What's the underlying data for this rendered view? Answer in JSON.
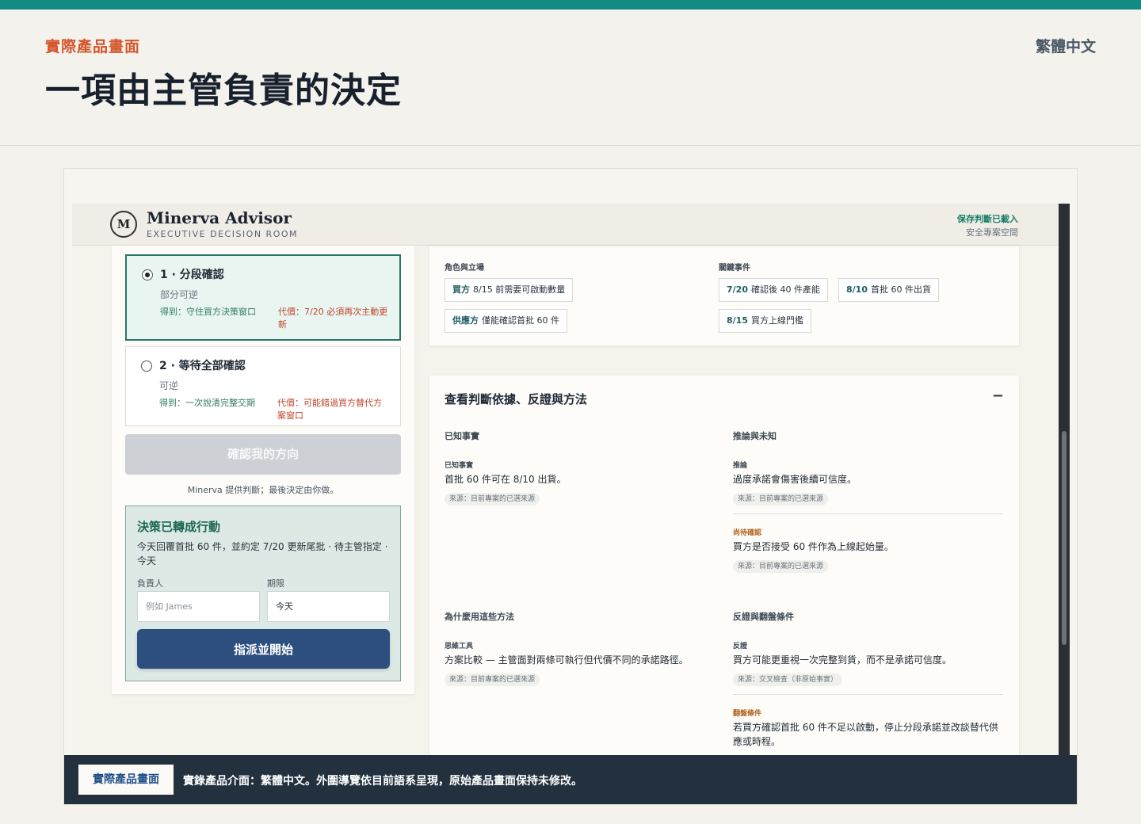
{
  "page": {
    "eyebrow": "實際產品畫面",
    "headline": "一項由主管負責的決定",
    "language": "繁體中文"
  },
  "app": {
    "brand_initial": "M",
    "brand_name": "Minerva Advisor",
    "brand_sub": "EXECUTIVE DECISION ROOM",
    "status_saved": "保存判斷已載入",
    "status_space": "安全專案空間"
  },
  "options": [
    {
      "title": "1 · 分段確認",
      "subtitle": "部分可逆",
      "gain": "得到：守住買方決策窗口",
      "cost": "代價：7/20 必須再次主動更新",
      "selected": true
    },
    {
      "title": "2 · 等待全部確認",
      "subtitle": "可逆",
      "gain": "得到：一次說清完整交期",
      "cost": "代價：可能錯過買方替代方案窗口",
      "selected": false
    }
  ],
  "confirm_button": "確認我的方向",
  "disclaimer": "Minerva 提供判斷；最後決定由你做。",
  "action": {
    "title": "決策已轉成行動",
    "description": "今天回覆首批 60 件，並約定 7/20 更新尾批 · 待主管指定 · 今天",
    "owner_label": "負責人",
    "owner_placeholder": "例如 James",
    "deadline_label": "期限",
    "deadline_value": "今天",
    "assign_button": "指派並開始"
  },
  "context": {
    "roles_label": "角色與立場",
    "events_label": "關鍵事件",
    "roles": [
      {
        "party": "買方",
        "text": "8/15 前需要可啟動數量"
      },
      {
        "party": "供應方",
        "text": "僅能確認首批 60 件"
      }
    ],
    "events": [
      {
        "date": "7/20",
        "text": "確認後 40 件產能"
      },
      {
        "date": "8/10",
        "text": "首批 60 件出貨"
      },
      {
        "date": "8/15",
        "text": "買方上線門檻"
      }
    ]
  },
  "evidence": {
    "title": "查看判斷依據、反證與方法",
    "collapse_icon": "−",
    "known_label": "已知事實",
    "inference_label": "推論與未知",
    "method_label": "為什麼用這些方法",
    "counter_label": "反證與翻盤條件",
    "known": {
      "tag": "已知事實",
      "text": "首批 60 件可在 8/10 出貨。",
      "source": "來源：目前專案的已選來源"
    },
    "inference": {
      "tag": "推論",
      "text": "過度承諾會傷害後續可信度。",
      "source": "來源：目前專案的已選來源"
    },
    "pending": {
      "tag": "尚待確認",
      "text": "買方是否接受 60 件作為上線起始量。",
      "source": "來源：目前專案的已選來源"
    },
    "method": {
      "tag": "思維工具",
      "text": "方案比較 — 主管面對兩條可執行但代價不同的承諾路徑。",
      "source": "來源：目前專案的已選來源"
    },
    "counter": {
      "tag": "反證",
      "text": "買方可能更重視一次完整到貨，而不是承諾可信度。",
      "source": "來源：交叉檢查（非原始事實）"
    },
    "flip": {
      "tag": "翻盤條件",
      "text": "若買方確認首批 60 件不足以啟動，停止分段承諾並改談替代供應或時程。"
    }
  },
  "caption": {
    "badge": "實際產品畫面",
    "text": "實錄產品介面：繁體中文。外圍導覽依目前語系呈現，原始產品畫面保持未修改。"
  },
  "colors": {
    "accent_teal": "#138a82",
    "eyebrow_orange": "#d4552b",
    "assign_blue": "#2c4f7f",
    "caption_dark": "#23303d"
  }
}
